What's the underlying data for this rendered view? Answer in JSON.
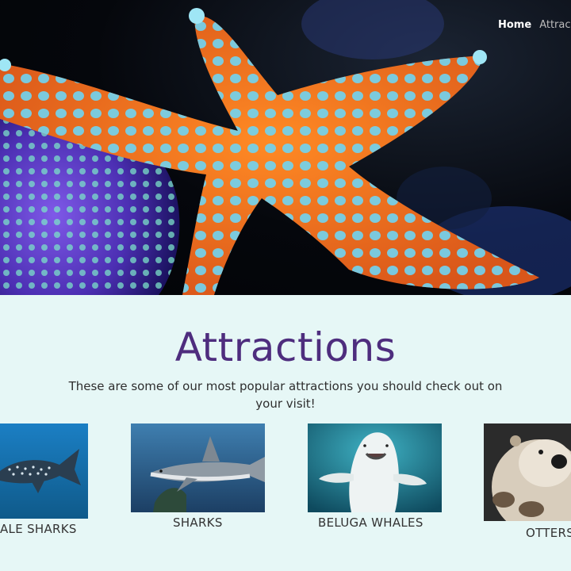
{
  "nav": {
    "home_label": "Home",
    "attractions_label": "Attrac"
  },
  "attractions": {
    "title": "Attractions",
    "description": "These are some of our most popular attractions you should check out on your visit!",
    "cards": [
      {
        "label": "ALE SHARKS"
      },
      {
        "label": "SHARKS"
      },
      {
        "label": "BELUGA WHALES"
      },
      {
        "label": "OTTERS"
      }
    ]
  },
  "colors": {
    "title": "#4e2d7e",
    "section_bg": "#e6f7f6"
  }
}
